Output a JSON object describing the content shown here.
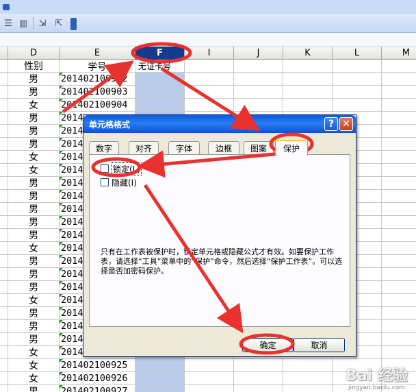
{
  "toolbar": {
    "icons": [
      "align-left-icon",
      "grid-icon",
      "decrease-decimal-icon",
      "increase-decimal-icon"
    ]
  },
  "sheet": {
    "columns": [
      "D",
      "E",
      "F",
      "I",
      "J",
      "K",
      "L",
      "M"
    ],
    "selected_column": "F",
    "header_row": {
      "d": "性别",
      "e": "学号",
      "f": "无证卡号"
    },
    "rows": [
      {
        "d": "男",
        "e": "201402100902"
      },
      {
        "d": "男",
        "e": "201402100903"
      },
      {
        "d": "女",
        "e": "201402100904"
      },
      {
        "d": "男",
        "e": "2014"
      },
      {
        "d": "男",
        "e": "2014"
      },
      {
        "d": "男",
        "e": "2014"
      },
      {
        "d": "女",
        "e": "2014"
      },
      {
        "d": "女",
        "e": "2014"
      },
      {
        "d": "男",
        "e": "2014"
      },
      {
        "d": "男",
        "e": "2014"
      },
      {
        "d": "男",
        "e": "2014"
      },
      {
        "d": "男",
        "e": "2014"
      },
      {
        "d": "男",
        "e": "2014"
      },
      {
        "d": "女",
        "e": "2014"
      },
      {
        "d": "男",
        "e": "2014"
      },
      {
        "d": "男",
        "e": "2014"
      },
      {
        "d": "男",
        "e": "2014"
      },
      {
        "d": "女",
        "e": "2014"
      },
      {
        "d": "男",
        "e": "2014"
      },
      {
        "d": "男",
        "e": "2014"
      },
      {
        "d": "男",
        "e": "2014"
      },
      {
        "d": "女",
        "e": "2014"
      },
      {
        "d": "女",
        "e": "201402100925"
      },
      {
        "d": "女",
        "e": "201402100926"
      },
      {
        "d": "男",
        "e": "201402100927"
      }
    ]
  },
  "dialog": {
    "title": "单元格格式",
    "help_label": "?",
    "close_label": "✕",
    "tabs": [
      "数字",
      "对齐",
      "字体",
      "边框",
      "图案",
      "保护"
    ],
    "active_tab": "保护",
    "locked_label": "锁定(L)",
    "hidden_label": "隐藏(I)",
    "description": "只有在工作表被保护时，锁定单元格或隐藏公式才有效。如要保护工作表，请选择“工具”菜单中的“保护”命令，然后选择“保护工作表”。可以选择是否加密码保护。",
    "ok_label": "确定",
    "cancel_label": "取消"
  },
  "watermark": {
    "brand": "Bai 经验",
    "url": "jingyan.baidu.com"
  },
  "colors": {
    "annotation": "#e8322f",
    "selected_header": "#163a8c",
    "selected_cells": "#b9cdeb"
  }
}
